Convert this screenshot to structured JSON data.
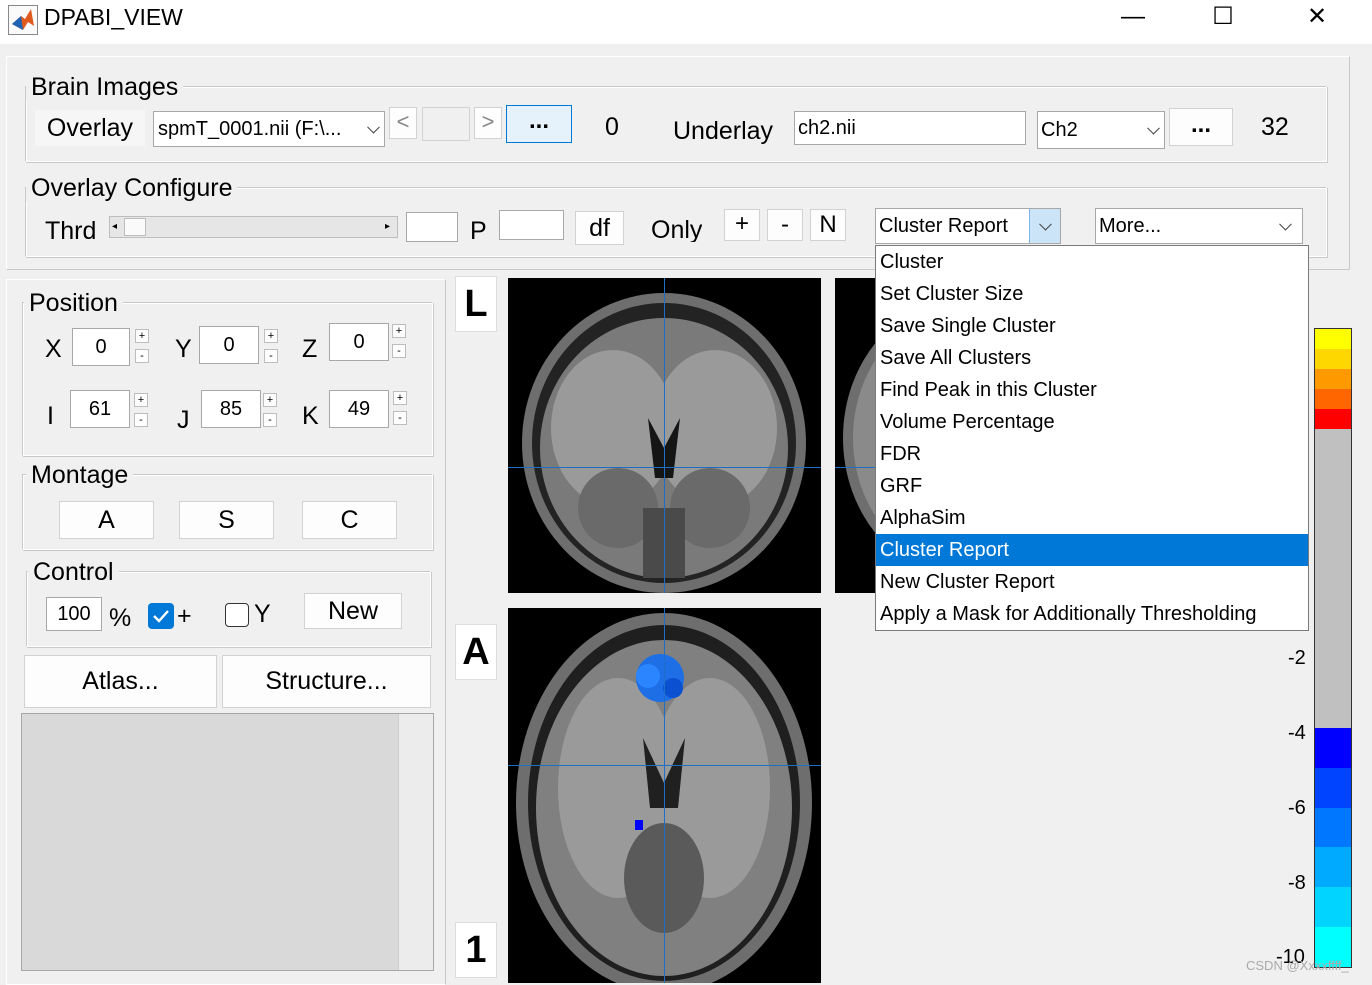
{
  "window": {
    "title": "DPABI_VIEW",
    "minimize": "—",
    "maximize": "☐",
    "close": "✕"
  },
  "brain_images": {
    "title": "Brain Images",
    "overlay_label": "Overlay",
    "overlay_file": "spmT_0001.nii (F:\\...",
    "prev": "<",
    "next": ">",
    "browse": "...",
    "overlay_count": "0",
    "underlay_label": "Underlay",
    "underlay_file": "ch2.nii",
    "underlay_template": "Ch2",
    "underlay_browse": "...",
    "underlay_count": "32"
  },
  "overlay_configure": {
    "title": "Overlay Configure",
    "thrd_label": "Thrd",
    "p_label": "P",
    "df_button": "df",
    "only_label": "Only",
    "plus": "+",
    "minus": "-",
    "n": "N",
    "cluster_select": "Cluster Report",
    "more_select": "More..."
  },
  "dropdown": {
    "items": [
      "Cluster",
      "Set Cluster Size",
      "Save Single Cluster",
      "Save All Clusters",
      "Find Peak in this Cluster",
      "Volume Percentage",
      "FDR",
      "GRF",
      "AlphaSim",
      "Cluster Report",
      "New Cluster Report",
      "Apply a Mask for Additionally Thresholding"
    ],
    "selected": "Cluster Report"
  },
  "position": {
    "title": "Position",
    "x_label": "X",
    "x": "0",
    "y_label": "Y",
    "y": "0",
    "z_label": "Z",
    "z": "0",
    "i_label": "I",
    "i": "61",
    "j_label": "J",
    "j": "85",
    "k_label": "K",
    "k": "49",
    "inc": "+",
    "dec": "-"
  },
  "montage": {
    "title": "Montage",
    "a": "A",
    "s": "S",
    "c": "C"
  },
  "control": {
    "title": "Control",
    "percent_value": "100",
    "percent_sign": "%",
    "crosshair_label": "+",
    "crosshair_checked": true,
    "y_label": "Y",
    "y_checked": false,
    "new_button": "New"
  },
  "atlas_button": "Atlas...",
  "structure_button": "Structure...",
  "view_letters": {
    "top": "L",
    "middle": "A",
    "bottom": "1"
  },
  "colorbar": {
    "ticks": [
      "-2",
      "-4",
      "-6",
      "-8",
      "-10"
    ],
    "colors": [
      "#ffff00",
      "#ffd700",
      "#ff9900",
      "#ff6600",
      "#ff0000",
      "#c0c0c0",
      "#0000ff",
      "#0044ff",
      "#0077ff",
      "#00aaff",
      "#00d4ff",
      "#00ffff"
    ]
  },
  "watermark": "CSDN @Xxxxffff_"
}
